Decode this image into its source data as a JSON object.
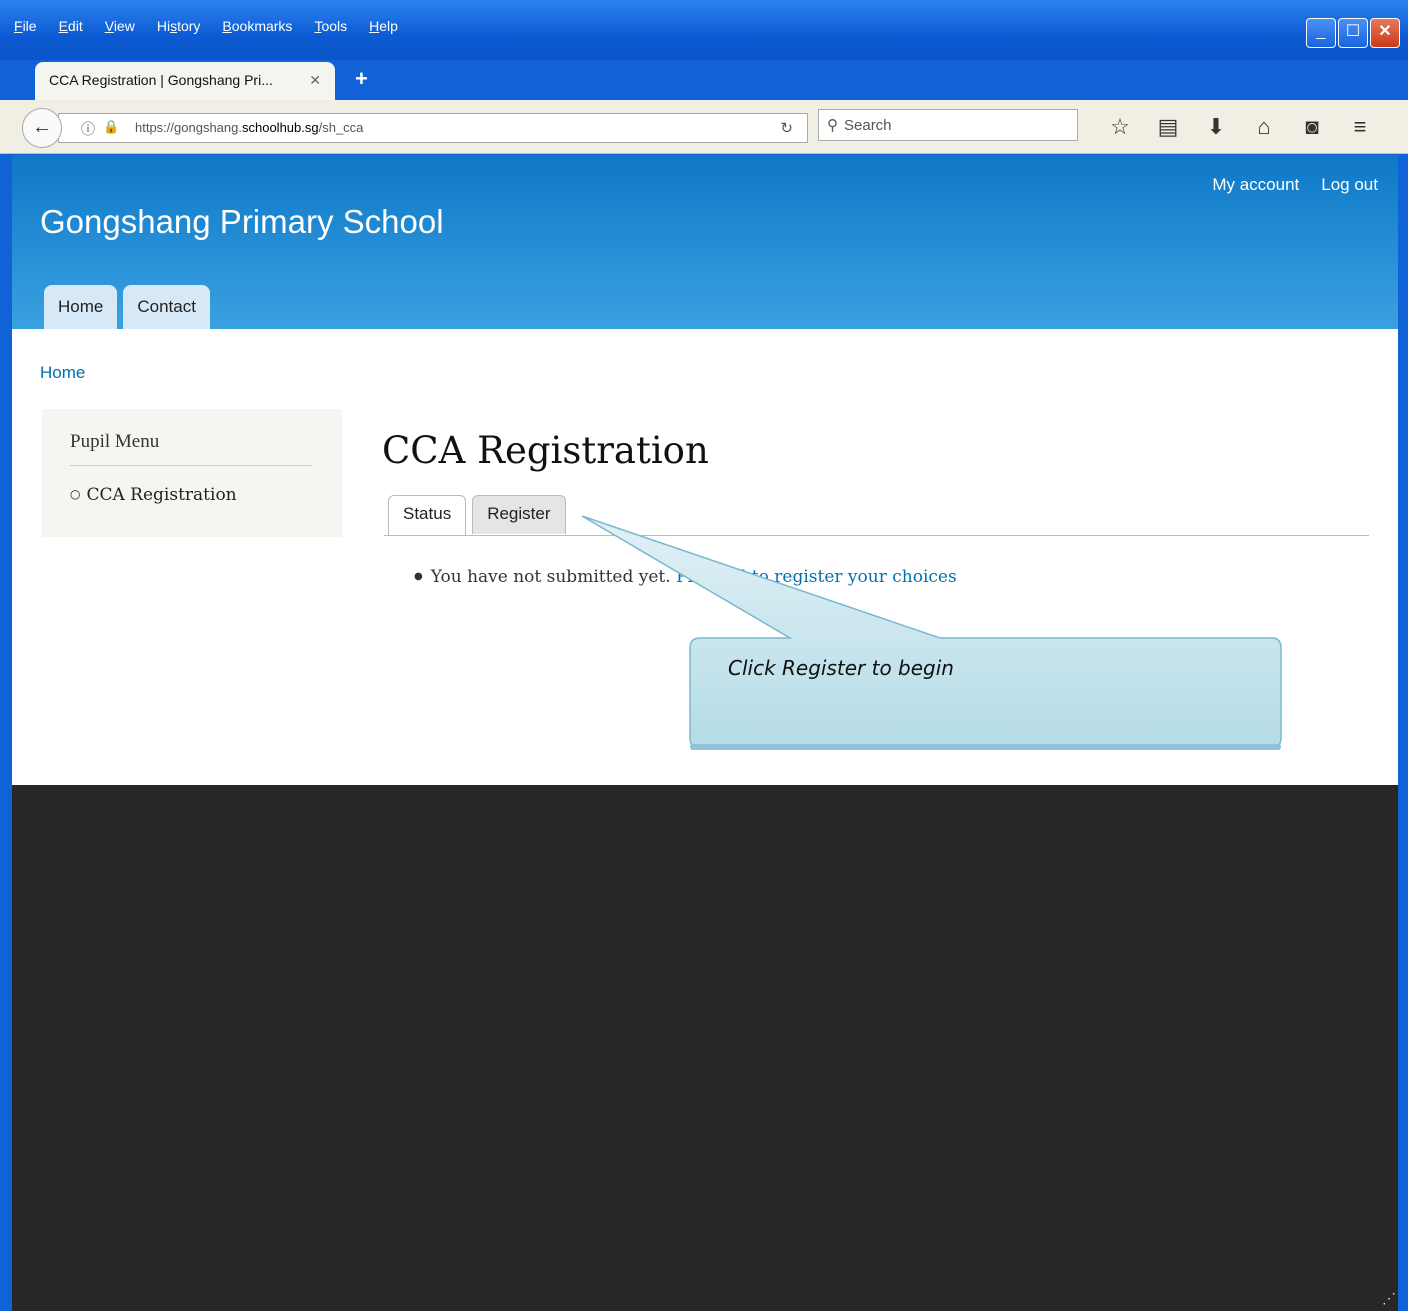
{
  "menu": [
    "File",
    "Edit",
    "View",
    "History",
    "Bookmarks",
    "Tools",
    "Help"
  ],
  "menu_underline": [
    "F",
    "E",
    "V",
    "s",
    "B",
    "T",
    "H"
  ],
  "window_buttons": [
    "minimize-icon",
    "maximize-icon",
    "close-icon"
  ],
  "browser_tab": {
    "title": "CCA Registration | Gongshang Pri...",
    "close": "✕"
  },
  "new_tab": "+",
  "address": {
    "prefix": "https://gongshang.",
    "domain": "schoolhub.sg",
    "path": "/sh_cca"
  },
  "search": {
    "placeholder": "Search"
  },
  "toolbar_icons": [
    "star-icon",
    "reading-list-icon",
    "download-icon",
    "home-icon",
    "pocket-icon",
    "hamburger-menu-icon"
  ],
  "site": {
    "name": "Gongshang Primary School",
    "user_links": {
      "my_account": "My account",
      "log_out": "Log out"
    },
    "primary_tabs": [
      "Home",
      "Contact"
    ]
  },
  "breadcrumb": "Home",
  "sidebar": {
    "title": "Pupil Menu",
    "items": [
      "CCA Registration"
    ]
  },
  "main": {
    "title": "CCA Registration",
    "tabs": [
      "Status",
      "Register"
    ],
    "message_text": "You have not submitted yet.",
    "message_link": "Proceed to register your choices"
  },
  "callout": {
    "text": "Click Register to begin"
  },
  "colors": {
    "header_top": "#0e78c8",
    "header_bottom": "#3aa1e0",
    "link": "#0070b0",
    "footer": "#272727",
    "callout": "#b8dde8"
  }
}
